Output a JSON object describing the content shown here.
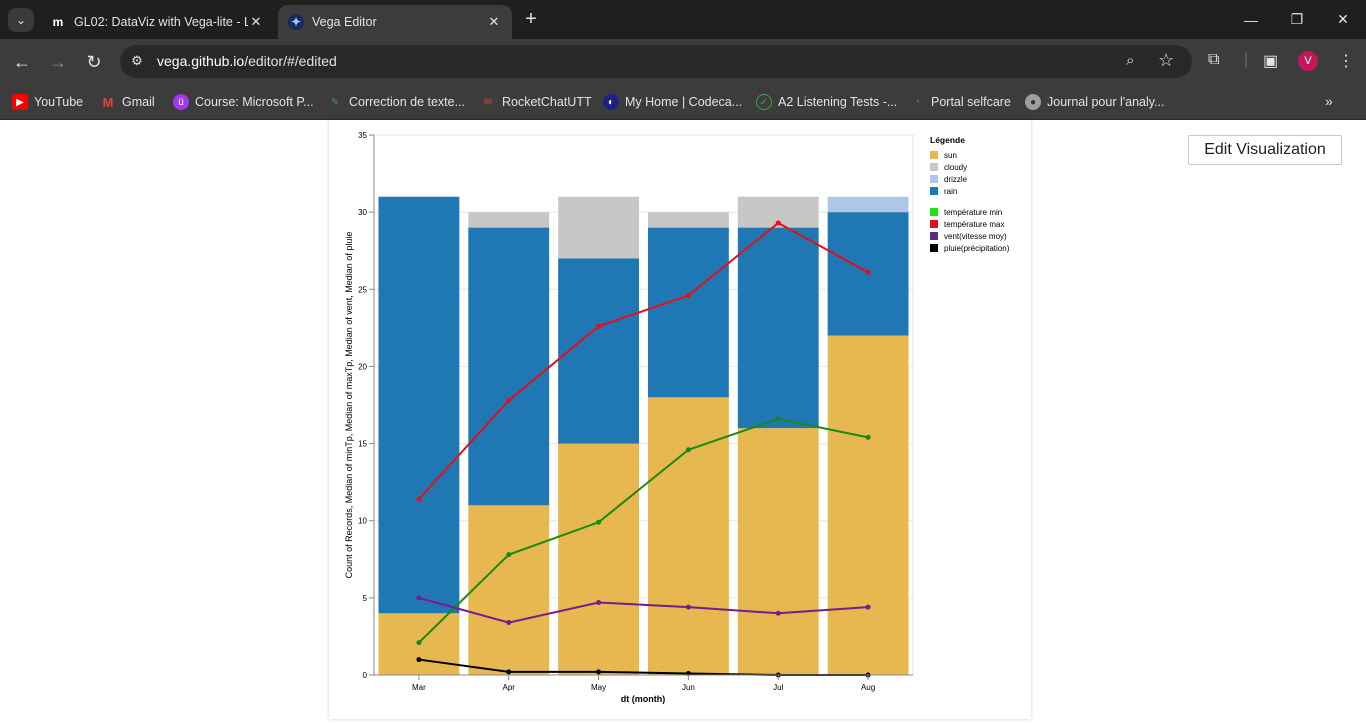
{
  "browser": {
    "tabs": [
      {
        "title": "GL02: DataViz with Vega-lite - L",
        "favicon": "moodle-icon",
        "active": false
      },
      {
        "title": "Vega Editor",
        "favicon": "vega-icon",
        "active": true
      }
    ],
    "address": {
      "host": "vega.github.io",
      "path": "/editor/#/edited"
    },
    "profile_initial": "V",
    "bookmarks": [
      {
        "label": "YouTube",
        "icon": "youtube-icon",
        "color": "#ff0000"
      },
      {
        "label": "Gmail",
        "icon": "gmail-icon",
        "color": "#ea4335"
      },
      {
        "label": "Course: Microsoft P...",
        "icon": "udemy-icon",
        "color": "#a435f0"
      },
      {
        "label": "Correction de texte...",
        "icon": "pen-icon",
        "color": "#2e7d32"
      },
      {
        "label": "RocketChatUTT",
        "icon": "rocketchat-icon",
        "color": "#e53935"
      },
      {
        "label": "My Home | Codeca...",
        "icon": "codecademy-icon",
        "color": "#1a237e"
      },
      {
        "label": "A2 Listening Tests -...",
        "icon": "check-icon",
        "color": "#43a047"
      },
      {
        "label": "Portal selfcare",
        "icon": "portal-icon",
        "color": "#1e88e5"
      },
      {
        "label": "Journal pour l'analy...",
        "icon": "journal-icon",
        "color": "#9e9e9e"
      }
    ]
  },
  "editor": {
    "edit_button": "Edit Visualization"
  },
  "chart_data": {
    "type": "bar",
    "categories": [
      "Mar",
      "Apr",
      "May",
      "Jun",
      "Jul",
      "Aug"
    ],
    "xlabel": "dt (month)",
    "ylabel": "Count of Records, Median of minTp, Median of maxTp, Median of vent, Median of pluie",
    "ylim": [
      0,
      35
    ],
    "yticks": [
      0,
      5,
      10,
      15,
      20,
      25,
      30,
      35
    ],
    "stacked_series": [
      {
        "name": "sun",
        "color": "#e6b84f",
        "values": [
          4,
          11,
          15,
          18,
          16,
          22
        ]
      },
      {
        "name": "rain",
        "color": "#1f77b4",
        "values": [
          27,
          18,
          12,
          11,
          13,
          8
        ]
      },
      {
        "name": "cloudy",
        "color": "#c7c7c7",
        "values": [
          0,
          1,
          4,
          1,
          2,
          0
        ]
      },
      {
        "name": "drizzle",
        "color": "#aec7e8",
        "values": [
          0,
          0,
          0,
          0,
          0,
          1
        ]
      }
    ],
    "line_series": [
      {
        "name": "température max",
        "color": "#e3101b",
        "values": [
          11.4,
          17.8,
          22.6,
          24.6,
          29.3,
          26.1
        ]
      },
      {
        "name": "température min",
        "color": "#1a8a10",
        "values": [
          2.1,
          7.8,
          9.9,
          14.6,
          16.6,
          15.4
        ]
      },
      {
        "name": "vent(vitesse moy)",
        "color": "#7a1a8c",
        "values": [
          5.0,
          3.4,
          4.7,
          4.4,
          4.0,
          4.4
        ]
      },
      {
        "name": "pluie(précipitation)",
        "color": "#000000",
        "values": [
          1.0,
          0.2,
          0.2,
          0.1,
          0.0,
          0.0
        ]
      }
    ],
    "legend": {
      "title": "Légende",
      "position": "right",
      "group1": [
        {
          "label": "sun",
          "color": "#e6b84f"
        },
        {
          "label": "cloudy",
          "color": "#c7c7c7"
        },
        {
          "label": "drizzle",
          "color": "#aec7e8"
        },
        {
          "label": "rain",
          "color": "#1f77b4"
        }
      ],
      "group2": [
        {
          "label": "température min",
          "color": "#19e619"
        },
        {
          "label": "température max",
          "color": "#e3101b"
        },
        {
          "label": "vent(vitesse moy)",
          "color": "#5a2d82"
        },
        {
          "label": "pluie(précipitation)",
          "color": "#000000"
        }
      ]
    }
  }
}
